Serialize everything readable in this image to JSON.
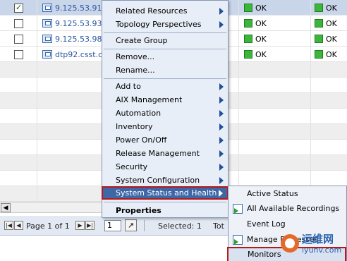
{
  "table": {
    "rows": [
      {
        "name": "9.125.53.91",
        "checked": true,
        "status1": "OK",
        "status2": "OK"
      },
      {
        "name": "9.125.53.93",
        "checked": false,
        "status1": "OK",
        "status2": "OK"
      },
      {
        "name": "9.125.53.98",
        "checked": false,
        "status1": "OK",
        "status2": "OK"
      },
      {
        "name": "dtp92.csst.c",
        "checked": false,
        "status1": "OK",
        "status2": "OK"
      }
    ]
  },
  "pager": {
    "page_text": "Page 1 of 1",
    "page_input": "1",
    "selected_text": "Selected: 1",
    "total_text": "Tot"
  },
  "menu": {
    "related_resources": "Related Resources",
    "topology_perspectives": "Topology Perspectives",
    "create_group": "Create Group",
    "remove": "Remove...",
    "rename": "Rename...",
    "add_to": "Add to",
    "aix_management": "AIX Management",
    "automation": "Automation",
    "inventory": "Inventory",
    "power_on_off": "Power On/Off",
    "release_management": "Release Management",
    "security": "Security",
    "system_configuration": "System Configuration",
    "system_status_and_health": "System Status and Health",
    "properties": "Properties"
  },
  "submenu": {
    "active_status": "Active Status",
    "all_available_recordings": "All Available Recordings",
    "event_log": "Event Log",
    "manage_processes": "Manage Processes",
    "monitors": "Monitors"
  },
  "watermark": {
    "line1": "运维网",
    "line2": "iyunv.com"
  },
  "colors": {
    "ok_green": "#3db53d",
    "menu_highlight": "#3e67a7",
    "annotation_red": "#b51a1a",
    "link_blue": "#2b56a0"
  }
}
